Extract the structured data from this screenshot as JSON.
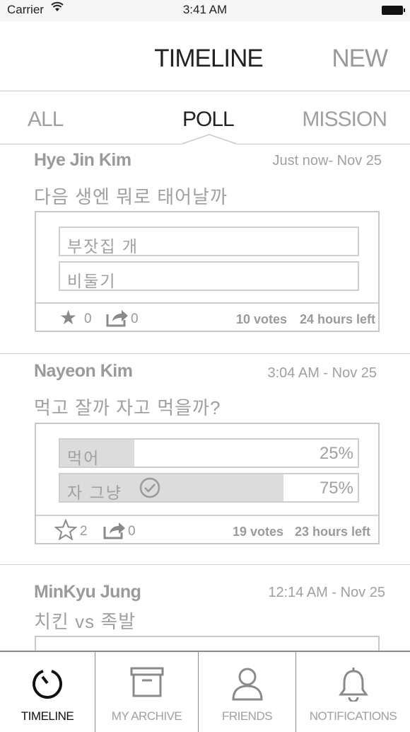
{
  "status_bar": {
    "carrier": "Carrier",
    "time": "3:41 AM"
  },
  "header": {
    "title": "TIMELINE",
    "new_label": "NEW"
  },
  "tabs": [
    {
      "label": "ALL"
    },
    {
      "label": "POLL"
    },
    {
      "label": "MISSION"
    }
  ],
  "active_tab": "POLL",
  "posts": [
    {
      "author": "Hye Jin Kim",
      "time": "Just now- Nov 25",
      "question": "다음 생엔 뭐로 태어날까",
      "options": [
        {
          "label": "부잣집 개"
        },
        {
          "label": "비둘기"
        }
      ],
      "stars": "0",
      "shares": "0",
      "votes": "10 votes",
      "time_left": "24 hours left"
    },
    {
      "author": "Nayeon Kim",
      "time": "3:04 AM - Nov 25",
      "question": "먹고 잘까 자고 먹을까?",
      "options": [
        {
          "label": "먹어",
          "percent_label": "25%",
          "fraction": 0.25,
          "selected": false
        },
        {
          "label": "자 그냥",
          "percent_label": "75%",
          "fraction": 0.75,
          "selected": true
        }
      ],
      "stars": "2",
      "shares": "0",
      "votes": "19 votes",
      "time_left": "23 hours left"
    },
    {
      "author": "MinKyu Jung",
      "time": "12:14 AM - Nov 25",
      "question": "치킨 vs 족발"
    }
  ],
  "tabbar": [
    {
      "label": "TIMELINE",
      "icon": "timeline-icon",
      "active": true
    },
    {
      "label": "MY ARCHIVE",
      "icon": "archive-box-icon",
      "active": false
    },
    {
      "label": "FRIENDS",
      "icon": "person-icon",
      "active": false
    },
    {
      "label": "NOTIFICATIONS",
      "icon": "bell-icon",
      "active": false
    }
  ],
  "colors": {
    "fill": "#dcdcdc",
    "active_text": "#111111",
    "muted_text": "#9a9a9a"
  }
}
